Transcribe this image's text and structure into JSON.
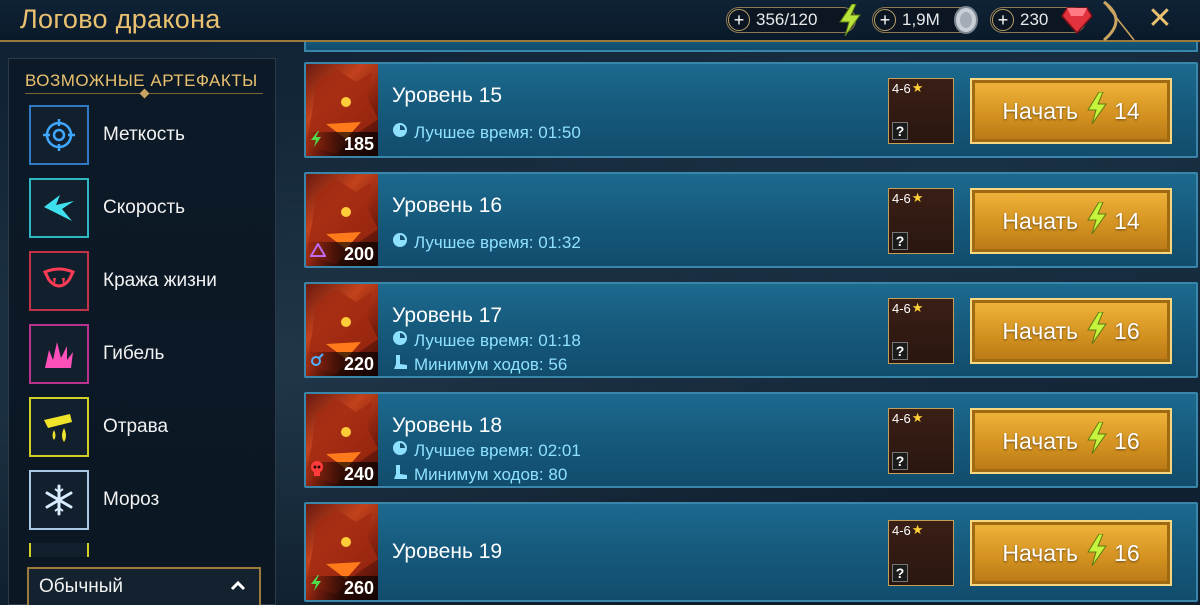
{
  "header": {
    "title": "Логово дракона",
    "resources": [
      {
        "name": "energy",
        "value": "356/120",
        "icon": "lightning-icon"
      },
      {
        "name": "silver",
        "value": "1,9M",
        "icon": "silver-coin-icon"
      },
      {
        "name": "gems",
        "value": "230",
        "icon": "ruby-icon"
      }
    ],
    "close_icon": "close-icon"
  },
  "sidebar": {
    "heading": "ВОЗМОЖНЫЕ АРТЕФАКТЫ",
    "artifacts": [
      {
        "label": "Меткость",
        "icon": "crosshair-icon",
        "color": "#2f79c6"
      },
      {
        "label": "Скорость",
        "icon": "swift-bird-icon",
        "color": "#2fb7c4"
      },
      {
        "label": "Кража жизни",
        "icon": "vampire-fangs-icon",
        "color": "#c2334a"
      },
      {
        "label": "Гибель",
        "icon": "destroy-burst-icon",
        "color": "#b9338e"
      },
      {
        "label": "Отрава",
        "icon": "poison-drops-icon",
        "color": "#cfcf24"
      },
      {
        "label": "Мороз",
        "icon": "snowflake-icon",
        "color": "#a8c8e6"
      }
    ],
    "filter": {
      "selected": "Обычный"
    }
  },
  "levels": [
    {
      "name": "Уровень 15",
      "power": "185",
      "power_icon": "green-bolt-icon",
      "best_time_label": "Лучшее время: 01:50",
      "min_turns_label": "",
      "rewards": "4-6",
      "cost": "14",
      "start_label": "Начать"
    },
    {
      "name": "Уровень 16",
      "power": "200",
      "power_icon": "purple-triangle-icon",
      "best_time_label": "Лучшее время: 01:32",
      "min_turns_label": "",
      "rewards": "4-6",
      "cost": "14",
      "start_label": "Начать"
    },
    {
      "name": "Уровень 17",
      "power": "220",
      "power_icon": "blue-gender-icon",
      "best_time_label": "Лучшее время: 01:18",
      "min_turns_label": "Минимум ходов: 56",
      "rewards": "4-6",
      "cost": "16",
      "start_label": "Начать"
    },
    {
      "name": "Уровень 18",
      "power": "240",
      "power_icon": "red-skull-icon",
      "best_time_label": "Лучшее время: 02:01",
      "min_turns_label": "Минимум ходов: 80",
      "rewards": "4-6",
      "cost": "16",
      "start_label": "Начать"
    },
    {
      "name": "Уровень 19",
      "power": "260",
      "power_icon": "green-bolt-icon",
      "best_time_label": "",
      "min_turns_label": "",
      "rewards": "4-6",
      "cost": "16",
      "start_label": "Начать"
    }
  ]
}
